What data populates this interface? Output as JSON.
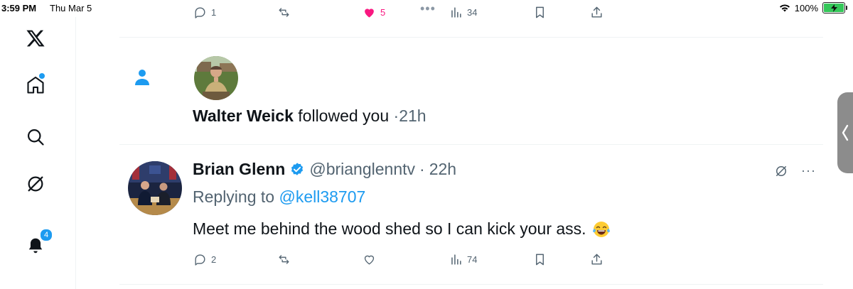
{
  "status_bar": {
    "time": "3:59 PM",
    "date": "Thu Mar 5",
    "battery": "100%"
  },
  "left_nav": {
    "items": [
      {
        "name": "x-logo-icon",
        "label": "X"
      },
      {
        "name": "home-icon",
        "has_dot": true
      },
      {
        "name": "search-icon"
      },
      {
        "name": "grok-icon"
      },
      {
        "name": "notifications-icon",
        "badge": "4"
      }
    ]
  },
  "top_tweet_actions": {
    "replies": "1",
    "likes": "5",
    "views": "34",
    "more": "•••"
  },
  "follow_notification": {
    "user_name": "Walter Weick",
    "action": "followed you",
    "separator": "·",
    "time": "21h"
  },
  "tweet": {
    "author_name": "Brian Glenn",
    "handle": "@brianglenntv",
    "separator": "·",
    "time": "22h",
    "replying_prefix": "Replying to",
    "replying_to": "@kell38707",
    "text": "Meet me behind the wood shed so I can kick your ass.",
    "actions": {
      "replies": "2",
      "views": "74"
    },
    "more": "···"
  },
  "colors": {
    "accent": "#1d9bf0",
    "like": "#f91880",
    "muted": "#536471",
    "text": "#0f1419",
    "divider": "#eff3f4"
  }
}
